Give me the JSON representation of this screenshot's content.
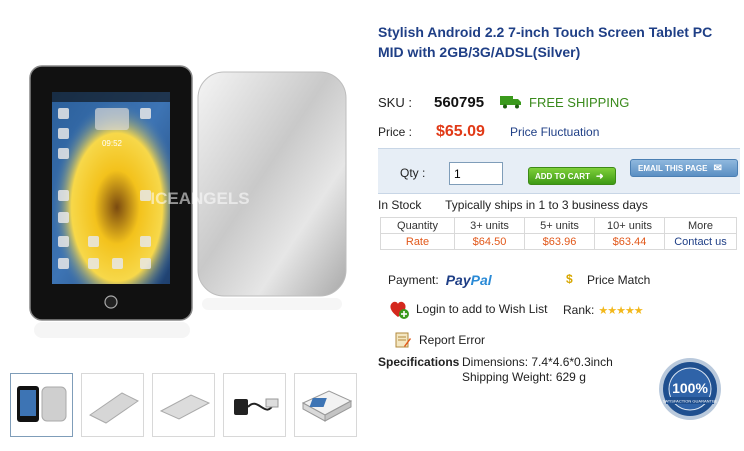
{
  "product": {
    "title": "Stylish Android 2.2 7-inch Touch Screen Tablet PC MID with 2GB/3G/ADSL(Silver)",
    "watermark": "ICEANGELS",
    "screen_time": "09:52"
  },
  "sku": {
    "label": "SKU :",
    "value": "560795",
    "shipping": "FREE SHIPPING"
  },
  "price": {
    "label": "Price :",
    "value": "$65.09",
    "fluctuation_link": "Price Fluctuation"
  },
  "cart": {
    "qty_label": "Qty :",
    "qty_value": "1",
    "add_to_cart": "ADD TO CART",
    "email_page": "EMAIL THIS PAGE"
  },
  "stock": {
    "status": "In Stock",
    "ships_text": "Typically ships in 1 to 3 business days"
  },
  "tier_pricing": {
    "headers": [
      "Quantity",
      "3+ units",
      "5+ units",
      "10+ units",
      "More"
    ],
    "values": [
      "Rate",
      "$64.50",
      "$63.96",
      "$63.44",
      "Contact us"
    ]
  },
  "payment": {
    "label": "Payment:",
    "pay": "Pay",
    "pal": "Pal",
    "dollar": "$",
    "price_match": "Price Match"
  },
  "wishlist": {
    "login_text": "Login to add to Wish List",
    "rank_label": "Rank:",
    "stars": "★★★★★"
  },
  "report": {
    "label": "Report Error"
  },
  "specifications": {
    "label": "Specifications",
    "dimensions": "Dimensions: 7.4*4.6*0.3inch",
    "weight": "Shipping Weight: 629 g"
  },
  "badge": {
    "percent": "100%",
    "text": "SATISFACTION GUARANTEE"
  },
  "colors": {
    "title_blue": "#1f3f86",
    "price_red": "#e13a17",
    "ship_green": "#3a8a1c",
    "tier_orange": "#e2581a",
    "cart_green": "#5ab326",
    "star_gold": "#f3b81b"
  }
}
